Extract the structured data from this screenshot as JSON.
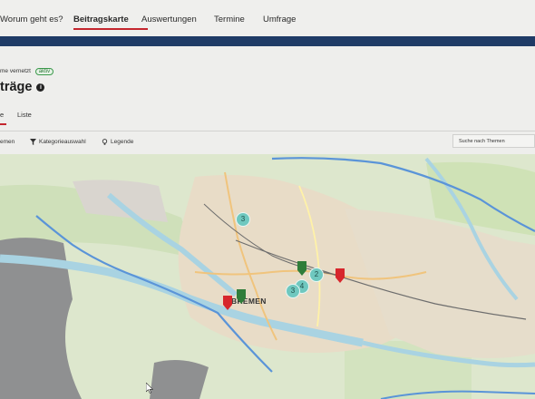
{
  "nav": {
    "items": [
      "Worum geht es?",
      "Beitragskarte",
      "Auswertungen",
      "Termine",
      "Umfrage"
    ],
    "active": "Beitragskarte"
  },
  "project": {
    "label": "me vernetzt",
    "status_badge": "aktiv"
  },
  "page": {
    "title": "träge"
  },
  "subtabs": {
    "active_label": "e",
    "list_label": "Liste"
  },
  "toolbar": {
    "themes_label": "emen",
    "category_label": "Kategorieauswahl",
    "legend_label": "Legende",
    "search_placeholder": "Suche nach Themen"
  },
  "map": {
    "city_label": "BREMEN",
    "clusters": [
      {
        "count": "3"
      },
      {
        "count": "2"
      },
      {
        "count": "4"
      },
      {
        "count": "3"
      }
    ],
    "marker_colors": {
      "red": "#d7262c",
      "green": "#2f7d3a"
    }
  },
  "colors": {
    "accent": "#c4262e",
    "brand_band": "#1f3b66",
    "cluster": "#6fc8bf",
    "badge": "#3c9a4c"
  }
}
